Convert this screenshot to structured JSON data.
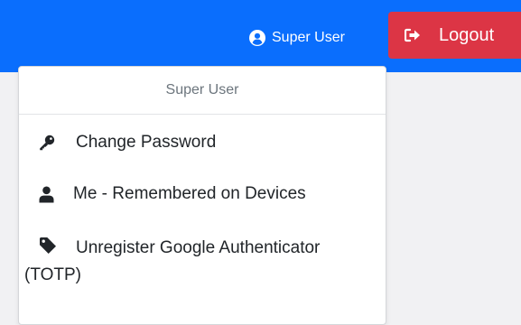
{
  "header": {
    "user_label": "Super User",
    "logout_label": "Logout",
    "user_icon": "user-circle-icon",
    "logout_icon": "sign-out-icon"
  },
  "dropdown": {
    "header": "Super User",
    "items": [
      {
        "label": "Change Password",
        "icon": "key-icon"
      },
      {
        "label": "Me - Remembered on Devices",
        "icon": "user-icon"
      },
      {
        "label": "Unregister Google Authenticator (TOTP)",
        "icon": "tag-icon"
      }
    ]
  },
  "colors": {
    "navbar": "#0a6efd",
    "logout": "#dc3545",
    "background": "#f1f1f3",
    "menu_text": "#212529",
    "menu_header": "#6c757d"
  }
}
